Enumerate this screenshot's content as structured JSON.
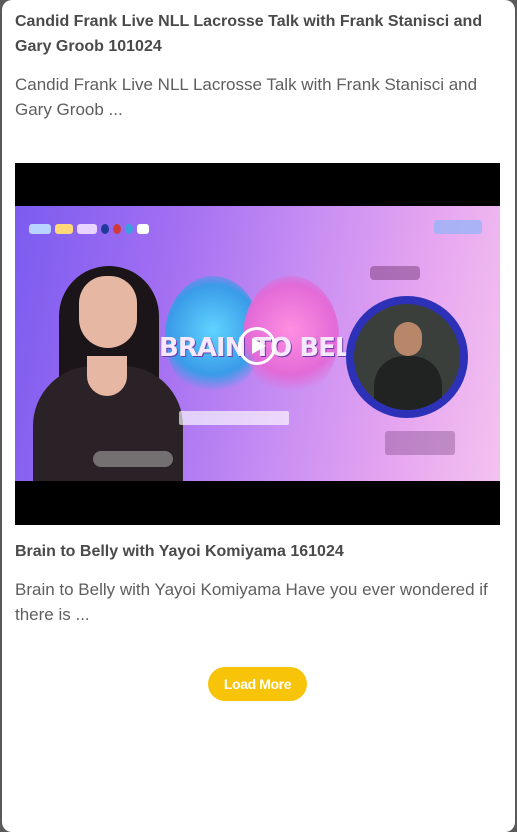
{
  "posts": [
    {
      "title": "Candid Frank Live NLL Lacrosse Talk with Frank Stanisci and Gary Groob 101024",
      "excerpt": "Candid Frank Live NLL Lacrosse Talk with Frank Stanisci and Gary Groob ..."
    },
    {
      "title": "Brain to Belly with Yayoi Komiyama 161024",
      "excerpt": "Brain to Belly with Yayoi Komiyama Have you ever wondered if there is ...",
      "video": {
        "thumbnail_text": "BRAIN TO BELLY",
        "play_icon": "play-circle-icon"
      }
    }
  ],
  "load_more_label": "Load More",
  "colors": {
    "panel_background": "#ffffff",
    "page_background": "#5a5a5a",
    "title_text": "#4a4a4a",
    "excerpt_text": "#5e5e5e",
    "load_more_button": "#f7c40a",
    "video_letterbox": "#000000"
  }
}
